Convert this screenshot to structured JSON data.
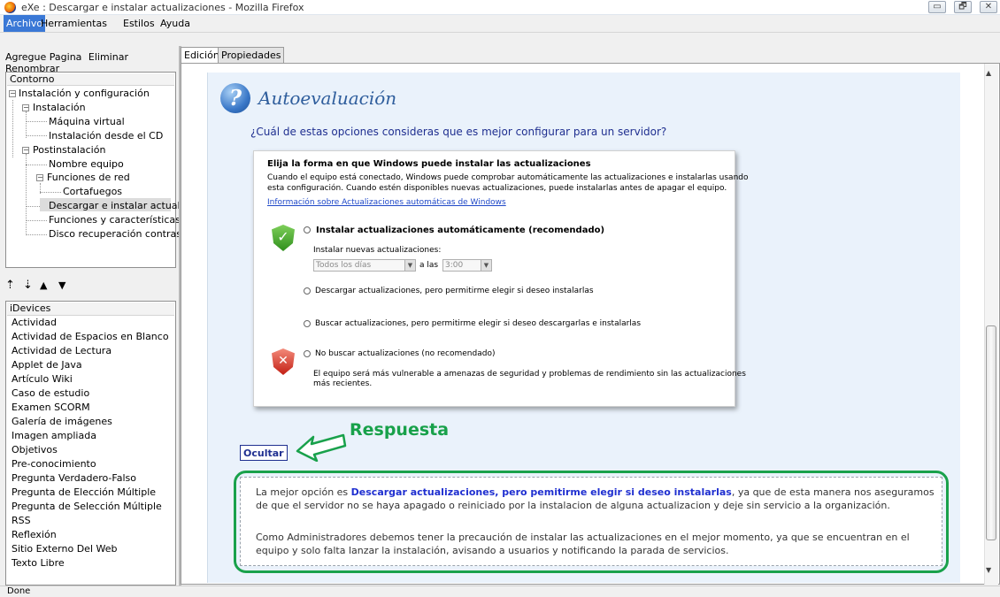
{
  "window": {
    "title": "eXe : Descargar e instalar actualizaciones - Mozilla Firefox",
    "minimize": "▭",
    "restore": "🗗",
    "close": "✕"
  },
  "menu": {
    "items": [
      "Archivo",
      "Herramientas",
      "Estilos",
      "Ayuda"
    ]
  },
  "page_toolbar": {
    "add": "Agregue Pagina",
    "delete": "Eliminar",
    "rename": "Renombrar"
  },
  "outline": {
    "header": "Contorno",
    "nodes": [
      "Instalación y configuración",
      "Instalación",
      "Máquina virtual",
      "Instalación desde el CD",
      "Postinstalación",
      "Nombre equipo",
      "Funciones de red",
      "Cortafuegos",
      "Descargar e instalar actualiz...",
      "Funciones y características",
      "Disco recuperación contras..."
    ]
  },
  "node_arrows": [
    "⇡",
    "⇣",
    "▲",
    "▼"
  ],
  "idevices": {
    "header": "iDevices",
    "items": [
      "Actividad",
      "Actividad de Espacios en Blanco",
      "Actividad de Lectura",
      "Applet de Java",
      "Artículo Wiki",
      "Caso de estudio",
      "Examen SCORM",
      "Galería de imágenes",
      "Imagen ampliada",
      "Objetivos",
      "Pre-conocimiento",
      "Pregunta Verdadero-Falso",
      "Pregunta de Elección Múltiple",
      "Pregunta de Selección Múltiple",
      "RSS",
      "Reflexión",
      "Sitio Externo Del Web",
      "Texto Libre"
    ]
  },
  "tabs": {
    "edicion": "Edición",
    "propiedades": "Propiedades"
  },
  "idevice": {
    "icon": "?",
    "title": "Autoevaluación",
    "question": "¿Cuál de estas opciones consideras que es mejor configurar para un servidor?"
  },
  "dialog": {
    "heading": "Elija la forma en que Windows puede instalar las actualizaciones",
    "desc1": "Cuando el equipo está conectado, Windows puede comprobar automáticamente las actualizaciones e instalarlas usando",
    "desc2": "esta configuración. Cuando estén disponibles nuevas actualizaciones, puede instalarlas antes de apagar el equipo.",
    "link": "Información sobre Actualizaciones automáticas de Windows",
    "opt1": "Instalar actualizaciones automáticamente (recomendado)",
    "install_label": "Instalar nuevas actualizaciones:",
    "day_value": "Todos los días",
    "at_label": "a las",
    "time_value": "3:00",
    "opt2": "Descargar actualizaciones, pero permitirme elegir si deseo instalarlas",
    "opt3": "Buscar actualizaciones, pero permitirme elegir si deseo descargarlas e instalarlas",
    "opt4": "No buscar actualizaciones (no recomendado)",
    "warn1": "El equipo será más vulnerable a amenazas de seguridad y problemas de rendimiento sin las actualizaciones",
    "warn2": "más recientes."
  },
  "feedback": {
    "hide_button": "Ocultar",
    "annotation": "Respuesta",
    "p1_pre": "La mejor opción es ",
    "p1_bold": "Descargar actualizaciones, pero pemitirme elegir si deseo instalarlas",
    "p1_post": ", ya que de esta manera nos aseguramos de que el servidor no se haya apagado o reiniciado por la instalacion de alguna actualizacion y deje sin servicio a la organización.",
    "p2": "Como Administradores debemos tener la precaución de instalar las actualizaciones en el mejor momento, ya que se encuentran en el equipo y solo falta lanzar la instalación, avisando a usuarios y notificando la parada de servicios."
  },
  "status": {
    "text": "Done"
  },
  "colors": {
    "accent": "#19a14b",
    "link": "#1f2f90",
    "menu_highlight": "#3a78d6"
  }
}
